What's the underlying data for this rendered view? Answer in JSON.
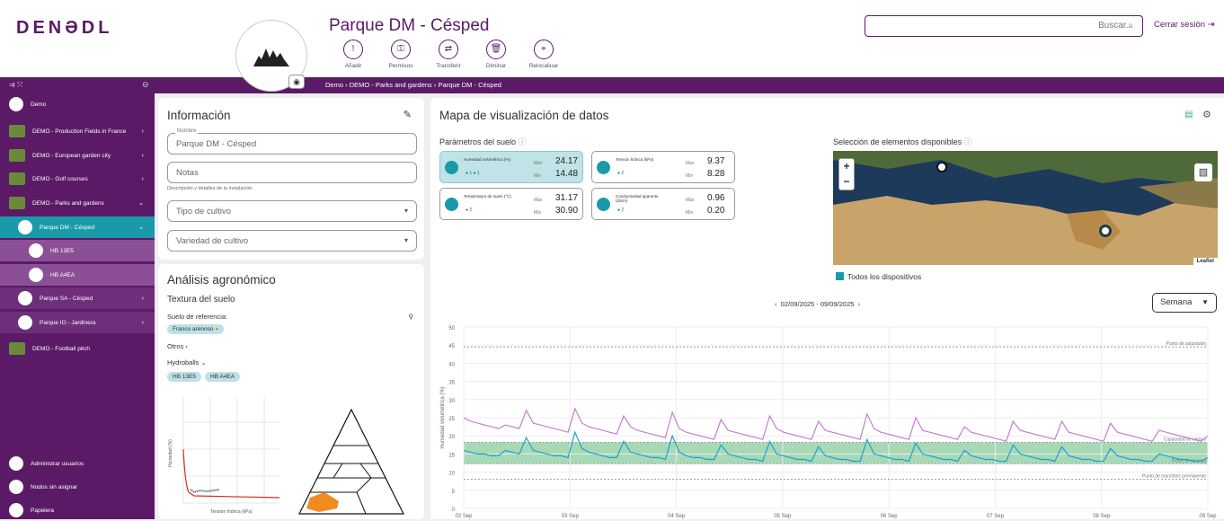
{
  "header": {
    "logo": "DENƏDL",
    "title": "Parque DM - Césped",
    "search_placeholder": "Buscar...",
    "logout": "Cerrar sesión",
    "actions": [
      {
        "label": "Añadir",
        "icon": "!"
      },
      {
        "label": "Permisos",
        "icon": "⚿"
      },
      {
        "label": "Transferir",
        "icon": "⇄"
      },
      {
        "label": "Diminar",
        "icon": "🗑"
      },
      {
        "label": "Relocaliuar",
        "icon": "⌖"
      }
    ]
  },
  "breadcrumb": [
    "Demo",
    "DEMO - Parks and gardens",
    "Parque DM - Césped"
  ],
  "sidebar": {
    "items": [
      {
        "label": "Demo",
        "chev": ""
      },
      {
        "label": "DEMO - Production Fields in France",
        "chev": "‹"
      },
      {
        "label": "DEMO - European garden city",
        "chev": "‹"
      },
      {
        "label": "DEMO - Golf courses",
        "chev": "‹"
      },
      {
        "label": "DEMO - Parks and gardens",
        "chev": "⌄"
      },
      {
        "label": "Parque DM - Césped",
        "chev": "⌄"
      },
      {
        "label": "HB 13E5",
        "chev": ""
      },
      {
        "label": "HB A4EA",
        "chev": ""
      },
      {
        "label": "Parque SA - Césped",
        "chev": "‹"
      },
      {
        "label": "Parque IO - Jardinera",
        "chev": "‹"
      },
      {
        "label": "DEMO - Football pitch",
        "chev": ""
      }
    ],
    "bottom": [
      "Administrar usuarios",
      "Nodos sin asignar",
      "Papelera"
    ]
  },
  "info": {
    "title": "Información",
    "nombre_label": "Nombre",
    "nombre": "Parque DM - Césped",
    "notas": "Notas",
    "notas_help": "Descripción y detalles de la instalación.",
    "tipo": "Tipo de cultivo",
    "variedad": "Variedad de cultivo"
  },
  "agro": {
    "title": "Análisis agronómico",
    "textura": "Textura del suelo",
    "suelo_ref": "Suelo de referencia:",
    "suelo_val": "Franco arenoso",
    "otros": "Otros",
    "hydroballs": "Hydroballs",
    "hb": [
      "HB 13E5",
      "HB A4EA"
    ],
    "humedad": "Humedad (%)",
    "tension": "Tensión hídrica (kPa)"
  },
  "mapa": {
    "title": "Mapa de visualización de datos",
    "params": "Parámetros del suelo",
    "sel": "Selección de elementos disponibles",
    "todos": "Todos los dispositivos",
    "leaflet": "Leaflet",
    "daterange": "02/09/2025 - 09/09/2025",
    "semana": "Semana"
  },
  "sensors": [
    {
      "name": "Humedad volumétrica (%)",
      "max": "24.17",
      "min": "14.48",
      "on": true,
      "dots": "● 1  ● 1"
    },
    {
      "name": "Tensión hídrica (kPa)",
      "max": "9.37",
      "min": "8.28",
      "on": false,
      "dots": "● 2"
    },
    {
      "name": "Temperatura de suelo (°C)",
      "max": "31.17",
      "min": "30.90",
      "on": false,
      "dots": "● 2"
    },
    {
      "name": "Conductividad aparente (dS/m)",
      "max": "0.96",
      "min": "0.20",
      "on": false,
      "dots": "● 2"
    }
  ],
  "sensor_labels": {
    "max": "Máx",
    "min": "Mín"
  },
  "chart_data": {
    "type": "line",
    "ylabel": "Humedad volumétrica (%)",
    "ylim": [
      0,
      50
    ],
    "yticks": [
      0,
      5,
      10,
      15,
      20,
      25,
      30,
      35,
      40,
      45,
      50
    ],
    "xticks": [
      "02 Sep",
      "03 Sep",
      "04 Sep",
      "05 Sep",
      "06 Sep",
      "07 Sep",
      "08 Sep",
      "09 Sep"
    ],
    "references": [
      {
        "label": "Punto de saturación",
        "value": 44.5
      },
      {
        "label": "Capacidad de campo",
        "value": 18.2
      },
      {
        "label": "Punto de recarga",
        "value": 12.3
      },
      {
        "label": "Punto de marchitez permanente",
        "value": 8
      }
    ],
    "band": [
      12.3,
      18.2
    ],
    "series": [
      {
        "color": "#c77cd1",
        "values": [
          25,
          24,
          23.5,
          23,
          22.5,
          22,
          23,
          22.5,
          22,
          27,
          23.5,
          23,
          22.5,
          22,
          21.5,
          21,
          27.5,
          23.5,
          22.5,
          22,
          21.5,
          21,
          20.5,
          25.5,
          22.5,
          21.5,
          21,
          20.5,
          20,
          19.5,
          26.5,
          22,
          21,
          20.5,
          20,
          19.5,
          19,
          24.5,
          21.5,
          21,
          20.5,
          20,
          19.5,
          19,
          25.5,
          22,
          21,
          20.5,
          20,
          19.5,
          19,
          24,
          21.5,
          21,
          20.5,
          20,
          19.5,
          19,
          26,
          22,
          21,
          20.5,
          20,
          19.5,
          19,
          25,
          21.5,
          21,
          20.5,
          20,
          19.5,
          19,
          22.5,
          21,
          20.5,
          20,
          19.5,
          19,
          18.5,
          24,
          21.5,
          21,
          20.5,
          20,
          19.5,
          19,
          24,
          21,
          20.5,
          20,
          19.5,
          19,
          18.5,
          23.5,
          21,
          20.5,
          20,
          19.5,
          19,
          18.5,
          21.5,
          21,
          20.5,
          20,
          19.5,
          19,
          18.5,
          20
        ]
      },
      {
        "color": "#1e9fd8",
        "values": [
          16,
          15.5,
          15,
          15,
          14.5,
          14.5,
          16,
          15.5,
          15,
          19.5,
          16,
          15.5,
          15,
          14.5,
          14.5,
          14,
          21,
          16.5,
          15.5,
          15,
          14.5,
          14,
          14,
          18.5,
          15.5,
          15,
          14.5,
          14,
          14,
          13.5,
          20,
          15.5,
          14.5,
          14,
          14,
          13.5,
          13.5,
          17.5,
          15,
          14.5,
          14,
          13.5,
          13.5,
          13,
          18.5,
          15,
          14.5,
          14,
          13.5,
          13.5,
          13,
          17,
          14.5,
          14,
          13.5,
          13.5,
          13,
          13,
          19,
          15,
          14.5,
          14,
          13.5,
          13.5,
          13,
          18,
          15,
          14.5,
          14,
          13.5,
          13.5,
          13,
          16,
          14.5,
          14,
          13.5,
          13.5,
          13,
          13,
          17.5,
          15,
          14.5,
          14,
          13.5,
          13.5,
          13,
          17,
          14.5,
          14,
          13.5,
          13.5,
          13,
          13,
          16.5,
          14.5,
          14,
          13.5,
          13.5,
          13,
          13,
          15,
          14.5,
          14,
          13.5,
          13.5,
          13,
          13,
          14
        ]
      }
    ]
  }
}
